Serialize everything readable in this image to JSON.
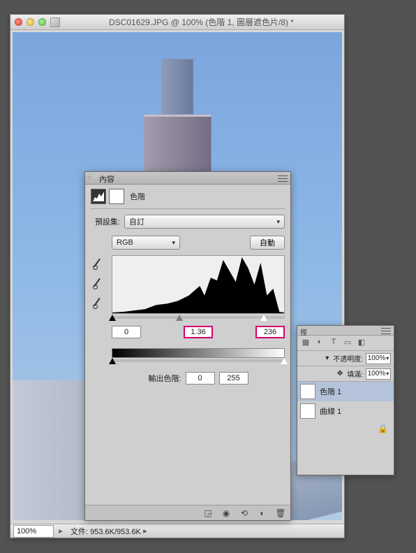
{
  "window": {
    "title": "DSC01629.JPG @ 100% (色階 1, 圖層遮色片/8) *"
  },
  "statusbar": {
    "zoom": "100%",
    "doc_info": "文件: 953.6K/953.6K"
  },
  "properties_panel": {
    "tab_title": "內容",
    "adj_type": "色階",
    "preset_label": "預設集:",
    "preset_value": "自訂",
    "channel_value": "RGB",
    "auto_btn": "自動",
    "input_black": "0",
    "input_gamma": "1.36",
    "input_white": "236",
    "output_label": "輸出色階:",
    "output_black": "0",
    "output_white": "255"
  },
  "layers_panel": {
    "tab_title": "徑",
    "opacity_label": "不透明度:",
    "opacity_value": "100%",
    "fill_label": "填滿:",
    "fill_value": "100%",
    "layer_levels": "色階 1",
    "layer_curves": "曲線 1"
  },
  "chart_data": {
    "type": "area",
    "title": "色階",
    "xlabel": "",
    "ylabel": "",
    "xlim": [
      0,
      255
    ],
    "x": [
      0,
      16,
      32,
      48,
      64,
      80,
      96,
      112,
      128,
      144,
      160,
      176,
      192,
      208,
      224,
      240,
      255
    ],
    "values": [
      1,
      2,
      4,
      6,
      12,
      14,
      18,
      26,
      40,
      52,
      48,
      78,
      62,
      82,
      74,
      36,
      2
    ],
    "markers": {
      "black": 0,
      "gamma": 1.36,
      "white": 236
    },
    "output_range": [
      0,
      255
    ]
  }
}
